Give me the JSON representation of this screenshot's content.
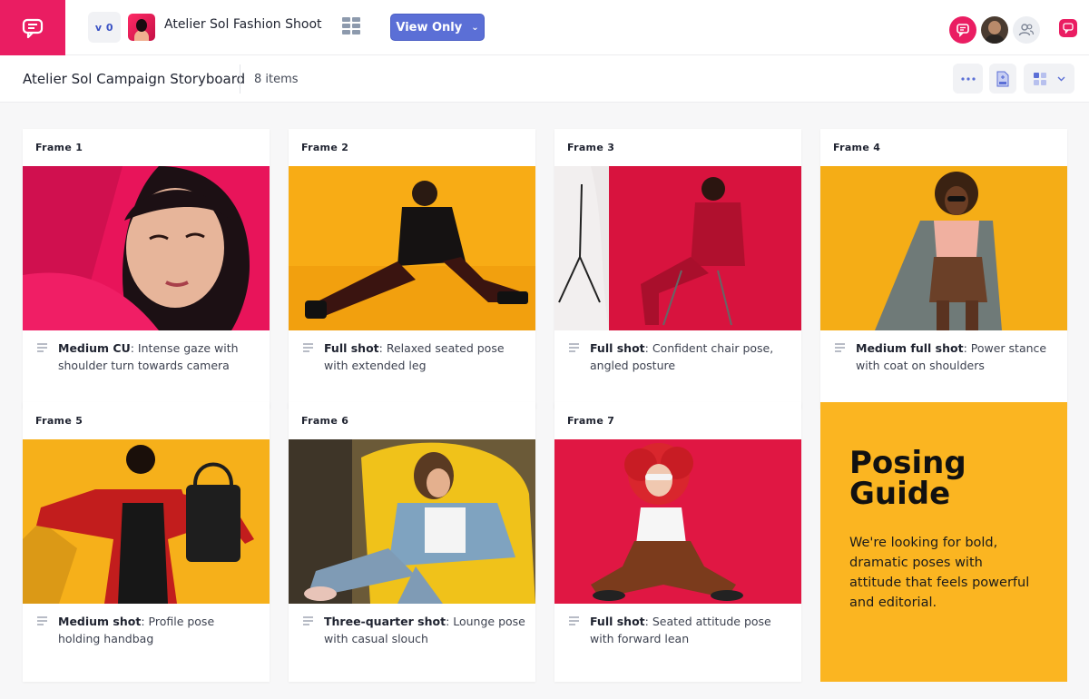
{
  "app": {
    "version_label": "v 0",
    "project_title": "Atelier Sol Fashion Shoot",
    "view_mode_label": "View Only",
    "brand_color": "#ea1d62",
    "accent_color": "#5b6fd6"
  },
  "board": {
    "title": "Atelier Sol Campaign Storyboard",
    "items_count": "8 items"
  },
  "frames": [
    {
      "label": "Frame  1",
      "shot": "Medium CU",
      "text": ": Intense gaze with shoulder turn towards camera",
      "bg": "#e8145a"
    },
    {
      "label": "Frame  2",
      "shot": "Full shot",
      "text": ": Relaxed seated pose with extended leg",
      "bg": "#f8ac15"
    },
    {
      "label": "Frame  3",
      "shot": "Full shot",
      "text": ": Confident chair pose, angled posture",
      "bg": "#d8133e"
    },
    {
      "label": "Frame  4",
      "shot": "Medium full shot",
      "text": ": Power stance with coat on shoulders",
      "bg": "#f5ad16"
    },
    {
      "label": "Frame  5",
      "shot": "Medium shot",
      "text": ": Profile pose holding handbag",
      "bg": "#f6b01a"
    },
    {
      "label": "Frame  6",
      "shot": "Three-quarter shot",
      "text": ": Lounge pose with casual slouch",
      "bg": "#7a6a40"
    },
    {
      "label": "Frame  7",
      "shot": "Full shot",
      "text": ": Seated attitude pose with forward lean",
      "bg": "#e01743"
    }
  ],
  "guide": {
    "title_line1": "Posing",
    "title_line2": "Guide",
    "body": "We're looking for bold, dramatic poses with attitude that feels powerful and editorial."
  }
}
